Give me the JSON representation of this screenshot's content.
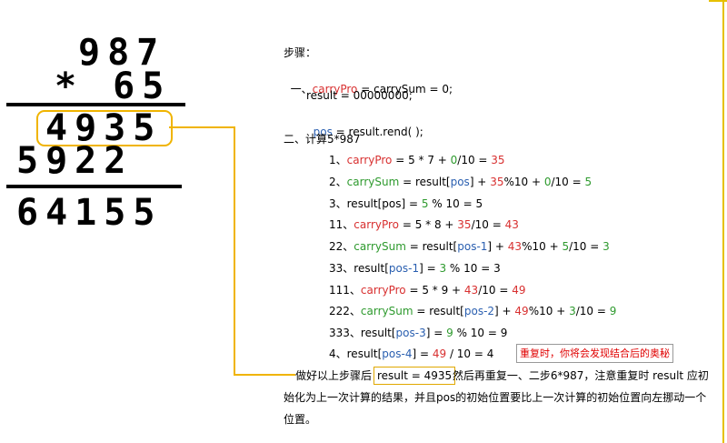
{
  "multiplication": {
    "multiplicand": "987",
    "multiplier_line": "* 65",
    "partial_1": "4935",
    "partial_2": "5922",
    "result": "64155"
  },
  "steps": {
    "title": "步骤：",
    "s1_prefix": "一、",
    "s1_a": "carryPro",
    "s1_b": " = carrySum = 0;",
    "s1_result": "result = 00000000;",
    "s1_pos_a": "pos",
    "s1_pos_b": " = result.rend( );",
    "s2_title": "二、计算5*987",
    "lines": {
      "l1": [
        "1、",
        "carryPro",
        " = 5 * 7 + ",
        "0",
        "/10 = ",
        "35"
      ],
      "l2": [
        "2、",
        "carrySum",
        " = result[",
        "pos",
        "] + ",
        "35",
        "%10 + ",
        "0",
        "/10 = ",
        "5"
      ],
      "l3": [
        "3、result[pos] = ",
        "5",
        " % 10 = 5"
      ],
      "l11": [
        "11、",
        "carryPro",
        " = 5 * 8 + ",
        "35",
        "/10 = ",
        "43"
      ],
      "l22": [
        "22、",
        "carrySum",
        " = result[",
        "pos-1",
        "] + ",
        "43",
        "%10 + ",
        "5",
        "/10 = ",
        "3"
      ],
      "l33": [
        "33、result[",
        "pos-1",
        "] = ",
        "3",
        " % 10 = 3"
      ],
      "l111": [
        "111、",
        "carryPro",
        " = 5 * 9 + ",
        "43",
        "/10 = ",
        "49"
      ],
      "l222": [
        "222、",
        "carrySum",
        " = result[",
        "pos-2",
        "] + ",
        "49",
        "%10 + ",
        "3",
        "/10 = ",
        "9"
      ],
      "l333": [
        "333、result[",
        "pos-3",
        "] = ",
        "9",
        " % 10 = 9"
      ],
      "l4": [
        "4、result[",
        "pos-4",
        "] = ",
        "49",
        " / 10 = 4"
      ]
    },
    "tip": "重复时，你将会发现结合后的奥秘",
    "para_prefix": "做好以上步骤后",
    "result_box": "result = 4935",
    "para_suffix": " 然后再重复一、二步6*987，注意重复时 result 应初",
    "para_line2": "始化为上一次计算的结果，并且pos的初始位置要比上一次计算的初始位置向左挪动一个",
    "para_line3": "位置。"
  },
  "colors": {
    "red": "#d83030",
    "green": "#2e9a2e",
    "blue": "#2a5fb0",
    "highlight": "#f0b400"
  }
}
